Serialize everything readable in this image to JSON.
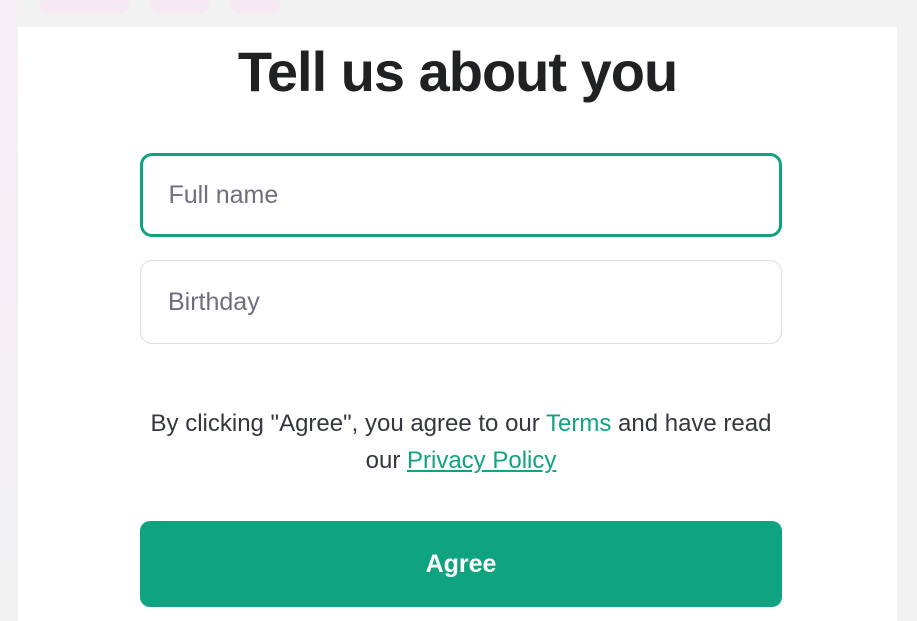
{
  "form": {
    "title": "Tell us about you",
    "full_name": {
      "value": "",
      "placeholder": "Full name"
    },
    "birthday": {
      "value": "",
      "placeholder": "Birthday"
    },
    "legal": {
      "prefix": "By clicking \"Agree\", you agree to our ",
      "terms_label": "Terms",
      "middle": " and have read our ",
      "privacy_label": "Privacy Policy"
    },
    "agree_label": "Agree"
  },
  "colors": {
    "accent": "#10a37f",
    "title": "#202123",
    "text": "#353740",
    "background": "#f2f2f3",
    "card": "#ffffff"
  }
}
